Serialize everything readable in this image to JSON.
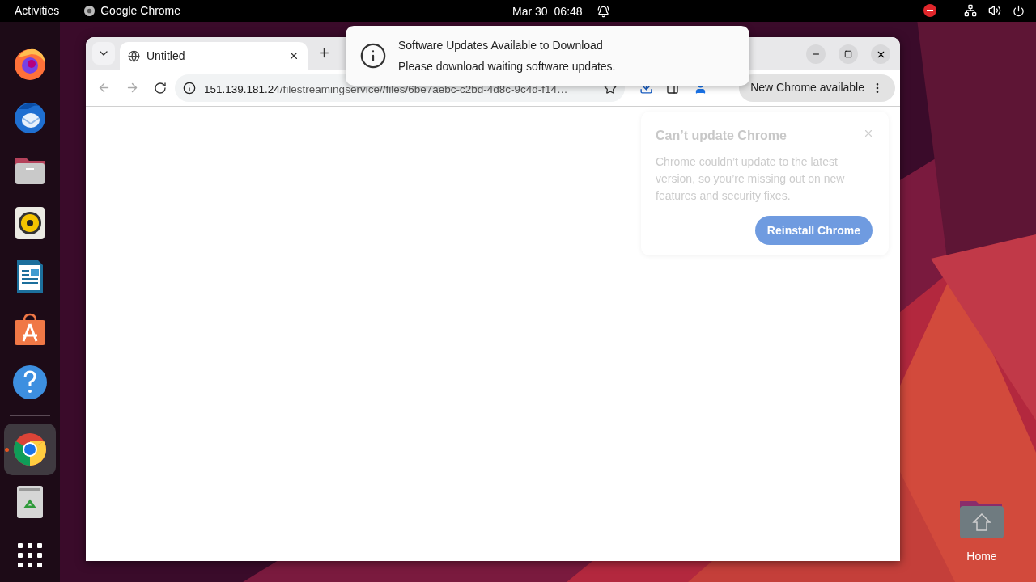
{
  "top_bar": {
    "activities": "Activities",
    "app": "Google Chrome",
    "date": "Mar 30",
    "time": "06:48"
  },
  "dock": {
    "items": [
      {
        "kind": "firefox",
        "selected": false,
        "running": false
      },
      {
        "kind": "thunderbird",
        "selected": false,
        "running": false
      },
      {
        "kind": "files",
        "selected": false,
        "running": false
      },
      {
        "kind": "rhythmbox",
        "selected": false,
        "running": false
      },
      {
        "kind": "writer",
        "selected": false,
        "running": false
      },
      {
        "kind": "appcenter",
        "selected": false,
        "running": false
      },
      {
        "kind": "help",
        "selected": false,
        "running": false
      },
      {
        "kind": "separator"
      },
      {
        "kind": "chrome",
        "selected": true,
        "running": true
      },
      {
        "kind": "trash",
        "selected": false,
        "running": false
      },
      {
        "kind": "apps",
        "selected": false,
        "running": false
      }
    ]
  },
  "desktop_icons": [
    {
      "label": "Home"
    }
  ],
  "browser": {
    "tabs": [
      {
        "title": "Untitled",
        "selected": true
      }
    ],
    "address": {
      "host": "151.139.181.24",
      "path": "/filestreamingservice//files/6be7aebc-c2bd-4d8c-9c4d-f14…"
    },
    "update_chip": "New Chrome available",
    "popup": {
      "title": "Can’t update Chrome",
      "body": "Chrome couldn’t update to the latest version, so you’re missing out on new features and security fixes.",
      "button": "Reinstall Chrome"
    }
  },
  "notification": {
    "title": "Software Updates Available to Download",
    "body": "Please download waiting software updates."
  }
}
